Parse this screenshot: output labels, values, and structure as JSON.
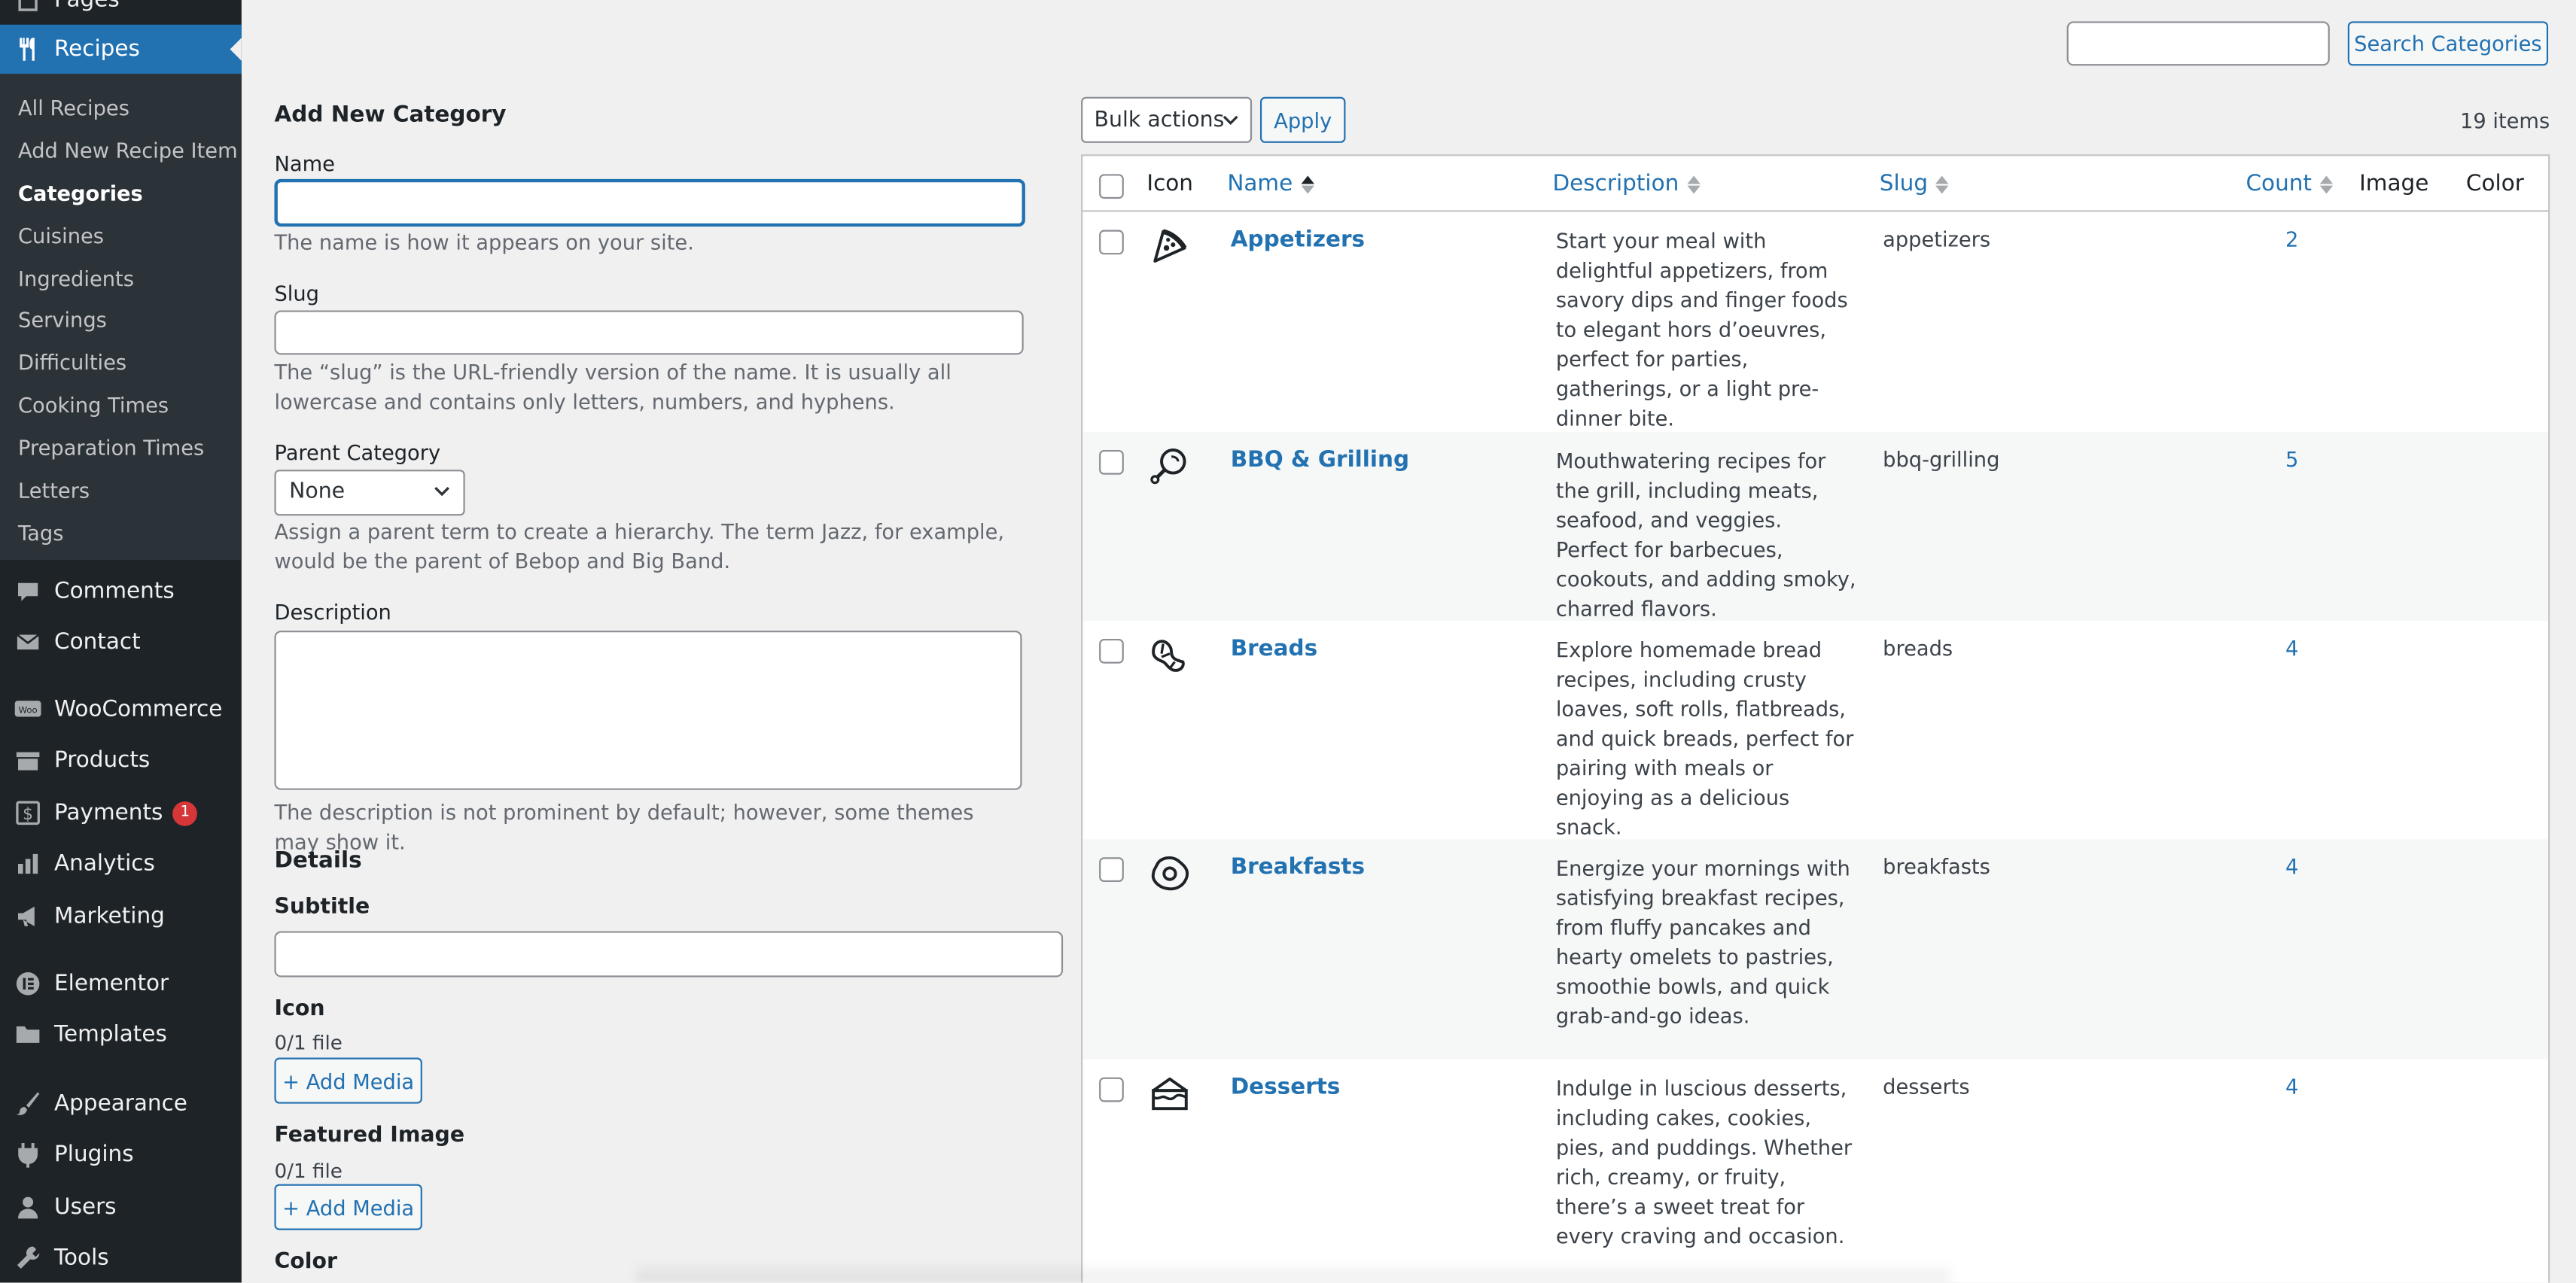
{
  "sidebar": {
    "pages_label": "Pages",
    "recipes_label": "Recipes",
    "submenu": [
      "All Recipes",
      "Add New Recipe Item",
      "Categories",
      "Cuisines",
      "Ingredients",
      "Servings",
      "Difficulties",
      "Cooking Times",
      "Preparation Times",
      "Letters",
      "Tags"
    ],
    "comments_label": "Comments",
    "contact_label": "Contact",
    "woocommerce_label": "WooCommerce",
    "products_label": "Products",
    "payments_label": "Payments",
    "payments_badge": "1",
    "analytics_label": "Analytics",
    "marketing_label": "Marketing",
    "elementor_label": "Elementor",
    "templates_label": "Templates",
    "appearance_label": "Appearance",
    "plugins_label": "Plugins",
    "users_label": "Users",
    "tools_label": "Tools"
  },
  "form": {
    "heading": "Add New Category",
    "name_label": "Name",
    "name_value": "",
    "name_help": "The name is how it appears on your site.",
    "slug_label": "Slug",
    "slug_value": "",
    "slug_help": "The “slug” is the URL-friendly version of the name. It is usually all lowercase and contains only letters, numbers, and hyphens.",
    "parent_label": "Parent Category",
    "parent_value": "None",
    "parent_help": "Assign a parent term to create a hierarchy. The term Jazz, for example, would be the parent of Bebop and Big Band.",
    "description_label": "Description",
    "description_value": "",
    "description_help": "The description is not prominent by default; however, some themes may show it.",
    "details_heading": "Details",
    "subtitle_label": "Subtitle",
    "subtitle_value": "",
    "icon_label": "Icon",
    "icon_files": "0/1 file",
    "icon_button": "+ Add Media",
    "featured_label": "Featured Image",
    "featured_files": "0/1 file",
    "featured_button": "+ Add Media",
    "color_label": "Color"
  },
  "toolbar": {
    "search_value": "",
    "search_button": "Search Categories",
    "bulk_value": "Bulk actions",
    "apply_button": "Apply",
    "items_count": "19 items"
  },
  "table": {
    "headers": {
      "icon": "Icon",
      "name": "Name",
      "description": "Description",
      "slug": "Slug",
      "count": "Count",
      "image": "Image",
      "color": "Color"
    },
    "rows": [
      {
        "icon": "pizza-slice-icon",
        "name": "Appetizers",
        "description": "Start your meal with delightful appetizers, from savory dips and finger foods to elegant hors d’oeuvres, perfect for parties, gatherings, or a light pre-dinner bite.",
        "slug": "appetizers",
        "count": "2"
      },
      {
        "icon": "drumstick-icon",
        "name": "BBQ & Grilling",
        "description": "Mouthwatering recipes for the grill, including meats, seafood, and veggies. Perfect for barbecues, cookouts, and adding smoky, charred flavors.",
        "slug": "bbq-grilling",
        "count": "5"
      },
      {
        "icon": "croissant-icon",
        "name": "Breads",
        "description": "Explore homemade bread recipes, including crusty loaves, soft rolls, flatbreads, and quick breads, perfect for pairing with meals or enjoying as a delicious snack.",
        "slug": "breads",
        "count": "4"
      },
      {
        "icon": "fried-egg-icon",
        "name": "Breakfasts",
        "description": "Energize your mornings with satisfying breakfast recipes, from fluffy pancakes and hearty omelets to pastries, smoothie bowls, and quick grab-and-go ideas.",
        "slug": "breakfasts",
        "count": "4"
      },
      {
        "icon": "cake-slice-icon",
        "name": "Desserts",
        "description": "Indulge in luscious desserts, including cakes, cookies, pies, and puddings. Whether rich, creamy, or fruity, there’s a sweet treat for every craving and occasion.",
        "slug": "desserts",
        "count": "4"
      }
    ]
  },
  "colors": {
    "accent": "#2271b1",
    "sidebar": "#1d2327",
    "submenu": "#2c3338",
    "badge": "#d63638"
  }
}
